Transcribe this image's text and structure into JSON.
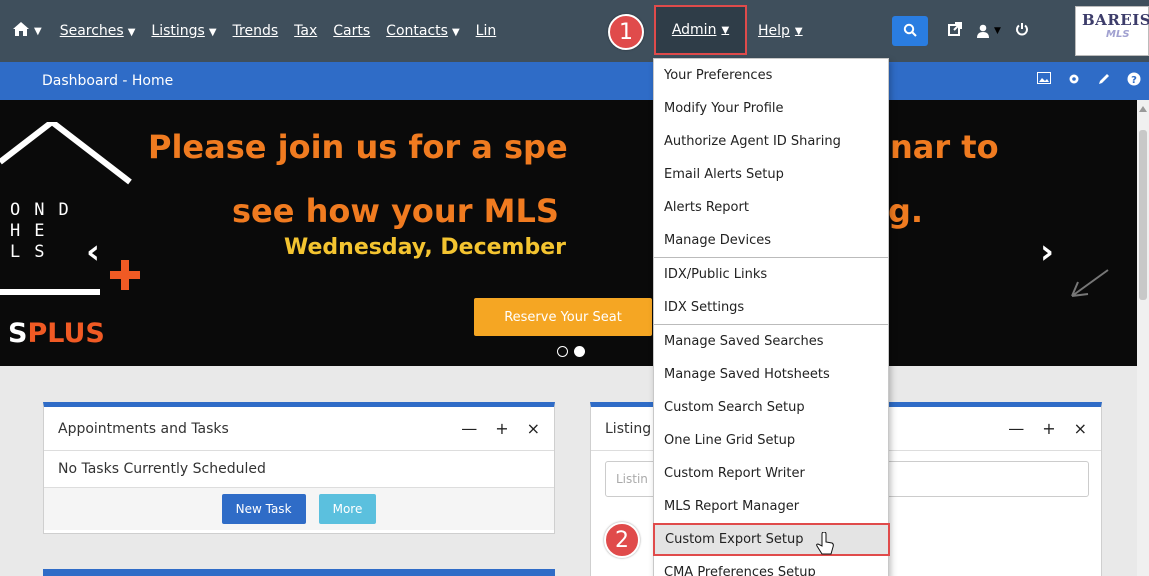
{
  "nav": {
    "home_icon": "home-icon",
    "items": [
      {
        "label": "Searches",
        "caret": true
      },
      {
        "label": "Listings",
        "caret": true
      },
      {
        "label": "Trends",
        "caret": false
      },
      {
        "label": "Tax",
        "caret": false
      },
      {
        "label": "Carts",
        "caret": false
      },
      {
        "label": "Contacts",
        "caret": true
      },
      {
        "label": "Lin",
        "caret": false
      }
    ],
    "admin_label": "Admin",
    "help_label": "Help",
    "logo_top": "BAREIS",
    "logo_bottom": "MLS"
  },
  "steps": {
    "one": "1",
    "two": "2"
  },
  "bluebar": {
    "title": "Dashboard - Home"
  },
  "banner": {
    "line1": "Please join us for a spe",
    "line1_tail": "nar to",
    "line2": "see how your MLS",
    "line2_tail": "g.",
    "date": "Wednesday, December",
    "reserve_label": "Reserve Your Seat",
    "left_letters": "OND\nHE\nLS",
    "splus_prefix": "S",
    "splus_bold": "PLUS"
  },
  "panels": {
    "tasks": {
      "title": "Appointments and Tasks",
      "empty_text": "No Tasks Currently Scheduled",
      "new_task_label": "New Task",
      "more_label": "More"
    },
    "listings": {
      "title": "Listing",
      "input_placeholder": "Listin"
    }
  },
  "admin_menu": {
    "groups": [
      [
        "Your Preferences",
        "Modify Your Profile",
        "Authorize Agent ID Sharing",
        "Email Alerts Setup",
        "Alerts Report",
        "Manage Devices"
      ],
      [
        "IDX/Public Links",
        "IDX Settings"
      ],
      [
        "Manage Saved Searches",
        "Manage Saved Hotsheets",
        "Custom Search Setup",
        "One Line Grid Setup",
        "Custom Report Writer",
        "MLS Report Manager",
        "Custom Export Setup",
        "CMA Preferences Setup"
      ]
    ],
    "highlighted": "Custom Export Setup"
  },
  "colors": {
    "accent_red": "#e04b4b",
    "nav_bg": "#3f4f5c",
    "blue": "#2f6cc7",
    "orange": "#f07b20"
  }
}
